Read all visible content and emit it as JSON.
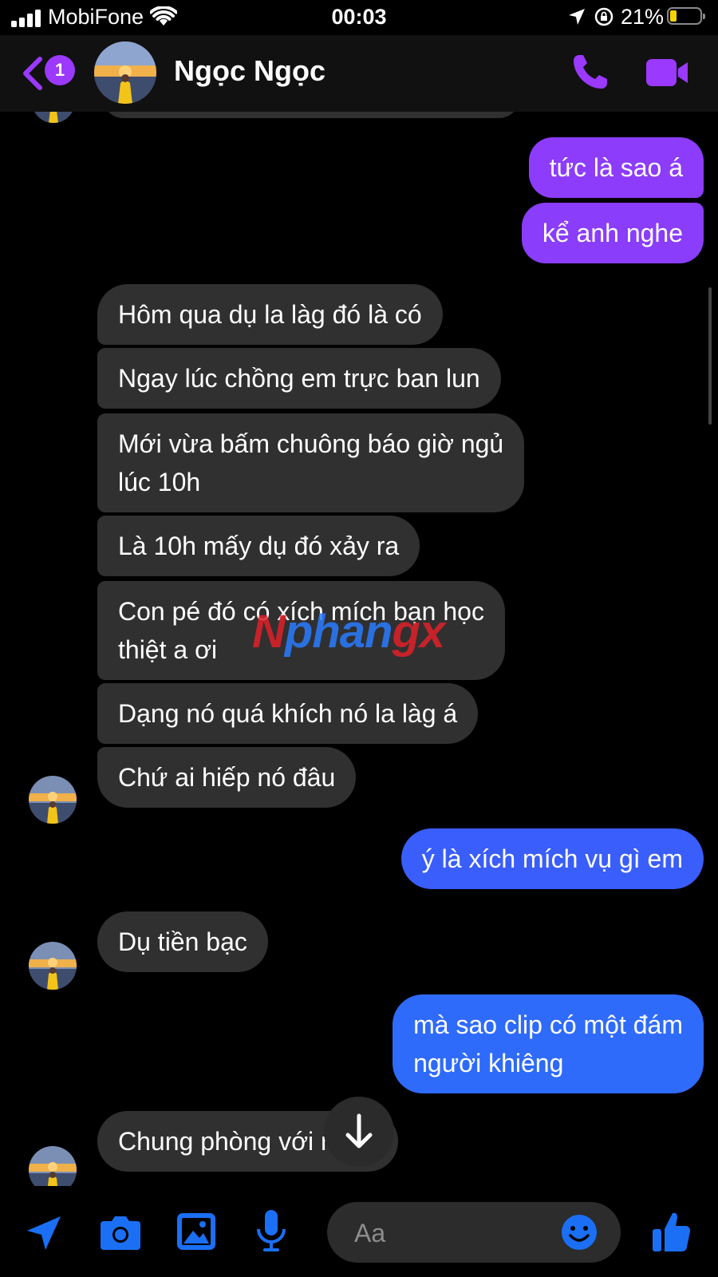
{
  "status_bar": {
    "carrier": "MobiFone",
    "time": "00:03",
    "battery_percent": "21%",
    "battery_level": 0.21,
    "battery_color": "#f5d300"
  },
  "header": {
    "unread_count": "1",
    "contact_name": "Ngọc Ngọc",
    "accent_color": "#9b39ff"
  },
  "watermark": {
    "part1": "N",
    "part2": "phan",
    "part3": "gx"
  },
  "messages": [
    {
      "side": "sent",
      "text": "tức là sao á",
      "color": "#8d3cfc"
    },
    {
      "side": "sent",
      "text": "kể anh nghe",
      "color": "#8a3dfb"
    },
    {
      "side": "received",
      "text": "Hôm qua dụ la làg đó là có"
    },
    {
      "side": "received",
      "text": "Ngay lúc chồng em trực ban lun"
    },
    {
      "side": "received",
      "lines": [
        "Mới vừa bấm chuông báo giờ ngủ",
        "lúc 10h"
      ]
    },
    {
      "side": "received",
      "text": "Là 10h mấy dụ đó xảy ra"
    },
    {
      "side": "received",
      "lines": [
        "Con pé đó có xích mích bạn học",
        "thiệt a ơi"
      ]
    },
    {
      "side": "received",
      "text": "Dạng nó quá khích nó la làg á"
    },
    {
      "side": "received",
      "text": "Chứ ai hiếp nó đâu"
    },
    {
      "side": "sent",
      "text": "ý là xích mích vụ gì em",
      "color": "#3a5efb"
    },
    {
      "side": "received",
      "text": "Dụ tiền bạc"
    },
    {
      "side": "sent",
      "lines": [
        "mà sao clip có một đám",
        "người khiêng"
      ],
      "color": "#2f6bfa"
    },
    {
      "side": "received",
      "text": "Chung phòng với nhau"
    }
  ],
  "composer": {
    "placeholder": "Aa",
    "icons": [
      "send-location-icon",
      "camera-icon",
      "gallery-icon",
      "microphone-icon",
      "emoji-icon",
      "thumbs-up-icon"
    ],
    "icon_color": "#1b6ff5"
  }
}
